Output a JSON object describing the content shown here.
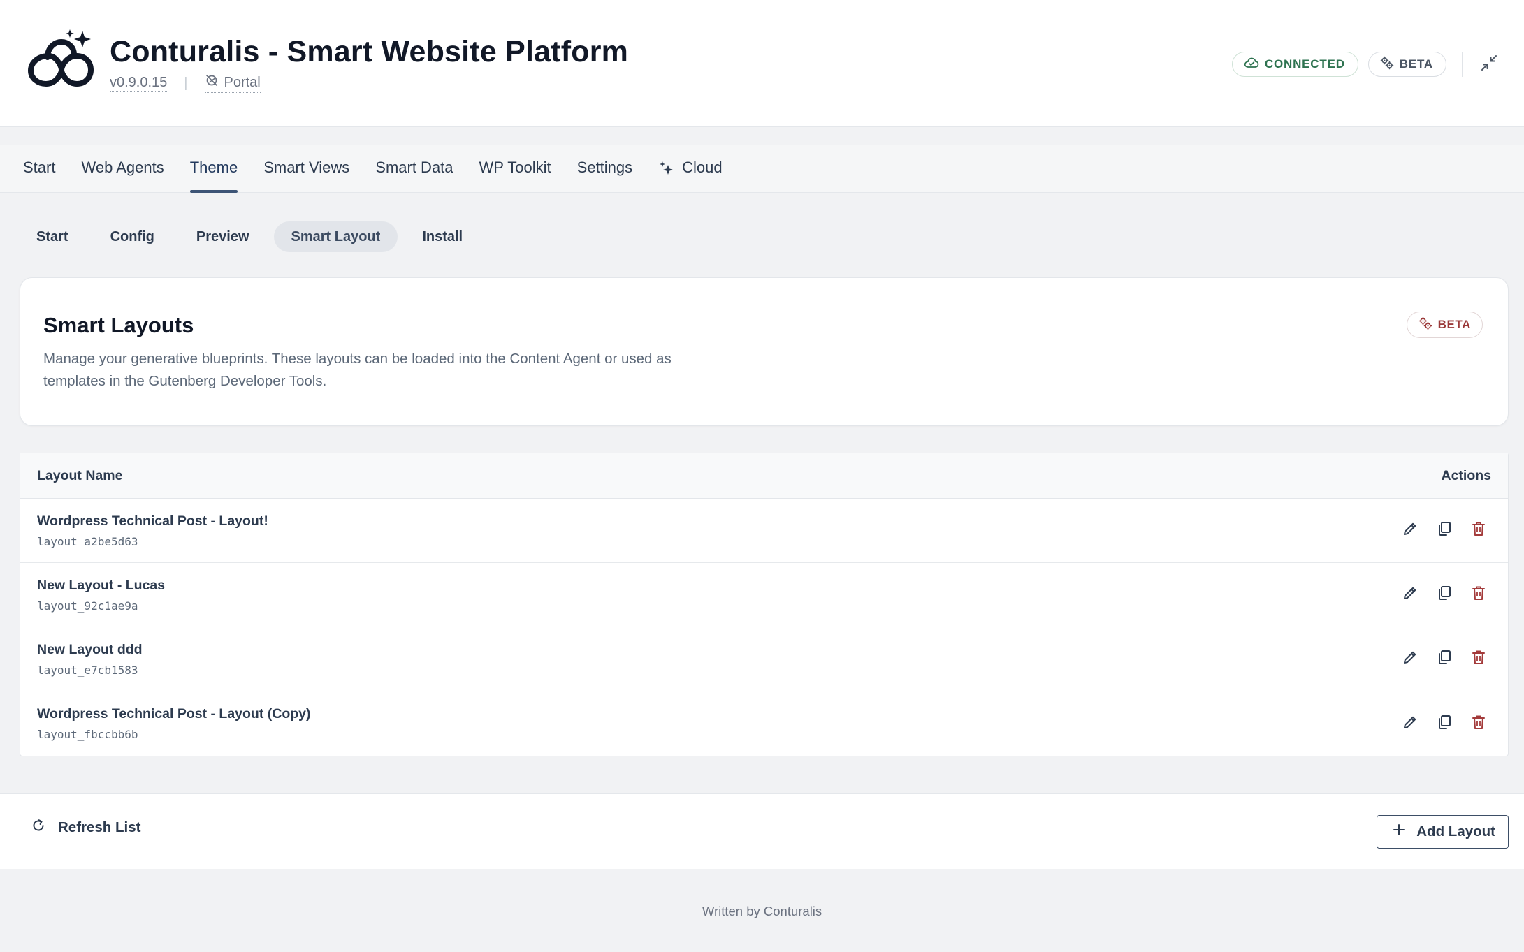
{
  "header": {
    "title": "Conturalis - Smart Website Platform",
    "version": "v0.9.0.15",
    "portal_label": "Portal",
    "status_badge": "CONNECTED",
    "beta_badge": "BETA",
    "logo_icon": "infinity-sparkle-logo-icon",
    "collapse_icon": "collapse-arrows-icon"
  },
  "main_nav": {
    "tabs": [
      {
        "label": "Start"
      },
      {
        "label": "Web Agents"
      },
      {
        "label": "Theme",
        "active": true
      },
      {
        "label": "Smart Views"
      },
      {
        "label": "Smart Data"
      },
      {
        "label": "WP Toolkit"
      },
      {
        "label": "Settings"
      },
      {
        "label": "Cloud",
        "icon": "sparkle-icon"
      }
    ]
  },
  "sub_nav": {
    "tabs": [
      {
        "label": "Start"
      },
      {
        "label": "Config"
      },
      {
        "label": "Preview"
      },
      {
        "label": "Smart Layout",
        "active": true
      },
      {
        "label": "Install"
      }
    ]
  },
  "intro": {
    "title": "Smart Layouts",
    "description": "Manage your generative blueprints. These layouts can be loaded into the Content Agent or used as templates in the Gutenberg Developer Tools.",
    "badge": "BETA"
  },
  "table": {
    "columns": {
      "name": "Layout Name",
      "actions": "Actions"
    },
    "rows": [
      {
        "name": "Wordpress Technical Post - Layout!",
        "id": "layout_a2be5d63"
      },
      {
        "name": "New Layout - Lucas",
        "id": "layout_92c1ae9a"
      },
      {
        "name": "New Layout ddd",
        "id": "layout_e7cb1583"
      },
      {
        "name": "Wordpress Technical Post - Layout (Copy)",
        "id": "layout_fbccbb6b"
      }
    ],
    "action_icons": [
      "edit-pencil-icon",
      "duplicate-icon",
      "delete-trash-icon"
    ]
  },
  "footer": {
    "refresh_label": "Refresh List",
    "add_label": "Add Layout",
    "credit": "Written by Conturalis"
  },
  "colors": {
    "connected": "#2e7350",
    "beta_red": "#9b3a3a",
    "nav_active": "#3d5476",
    "delete": "#a33a3a"
  }
}
